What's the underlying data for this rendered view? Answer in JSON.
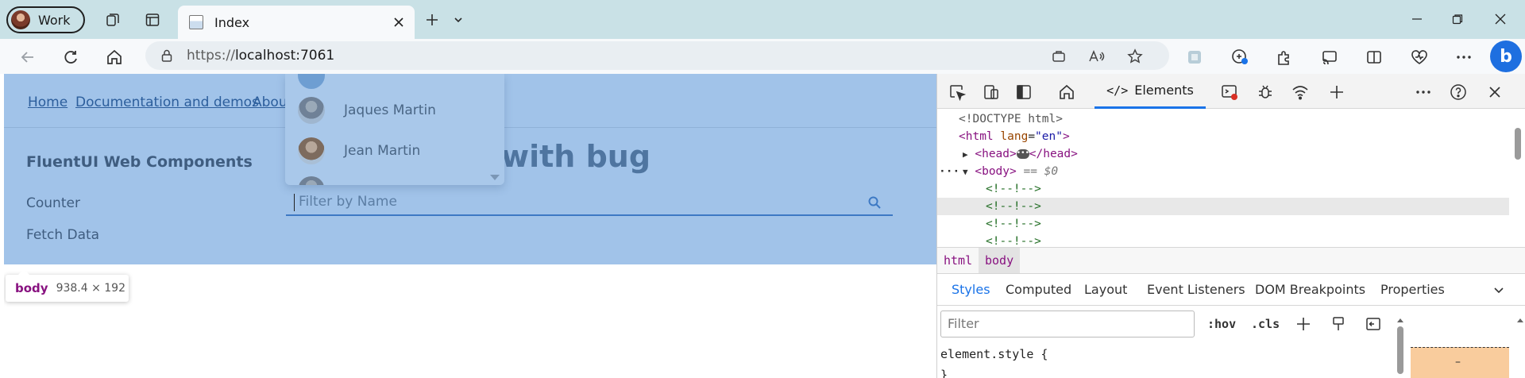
{
  "browser": {
    "profile_label": "Work",
    "tab_title": "Index",
    "url_prefix": "https://",
    "url_host": "localhost:7061"
  },
  "page": {
    "nav_links": [
      "Home",
      "Documentation and demos",
      "About"
    ],
    "app_title": "FluentUI Web Components",
    "side_links": [
      "Counter",
      "Fetch Data"
    ],
    "heading_fragment": "with bug",
    "filter_placeholder": "Filter by Name",
    "dropdown_items": [
      "Jaques Martin",
      "Jean Martin"
    ]
  },
  "tooltip": {
    "tag": "body",
    "size": "938.4 × 192"
  },
  "devtools": {
    "active_tab": "Elements",
    "dom": {
      "doctype": "<!DOCTYPE html>",
      "html_tag": "html",
      "html_attr": "lang",
      "html_val": "\"en\"",
      "head_open": "<head>",
      "head_close": "</head>",
      "body_tag": "<body>",
      "body_marker": "== $0",
      "comment": "<!--!-->"
    },
    "crumbs": [
      "html",
      "body"
    ],
    "sub_tabs": [
      "Styles",
      "Computed",
      "Layout",
      "Event Listeners",
      "DOM Breakpoints",
      "Properties"
    ],
    "filter_placeholder": "Filter",
    "hov_label": ":hov",
    "cls_label": ".cls",
    "element_style": "element.style {",
    "closing_brace": "}",
    "box_margin": "–"
  }
}
